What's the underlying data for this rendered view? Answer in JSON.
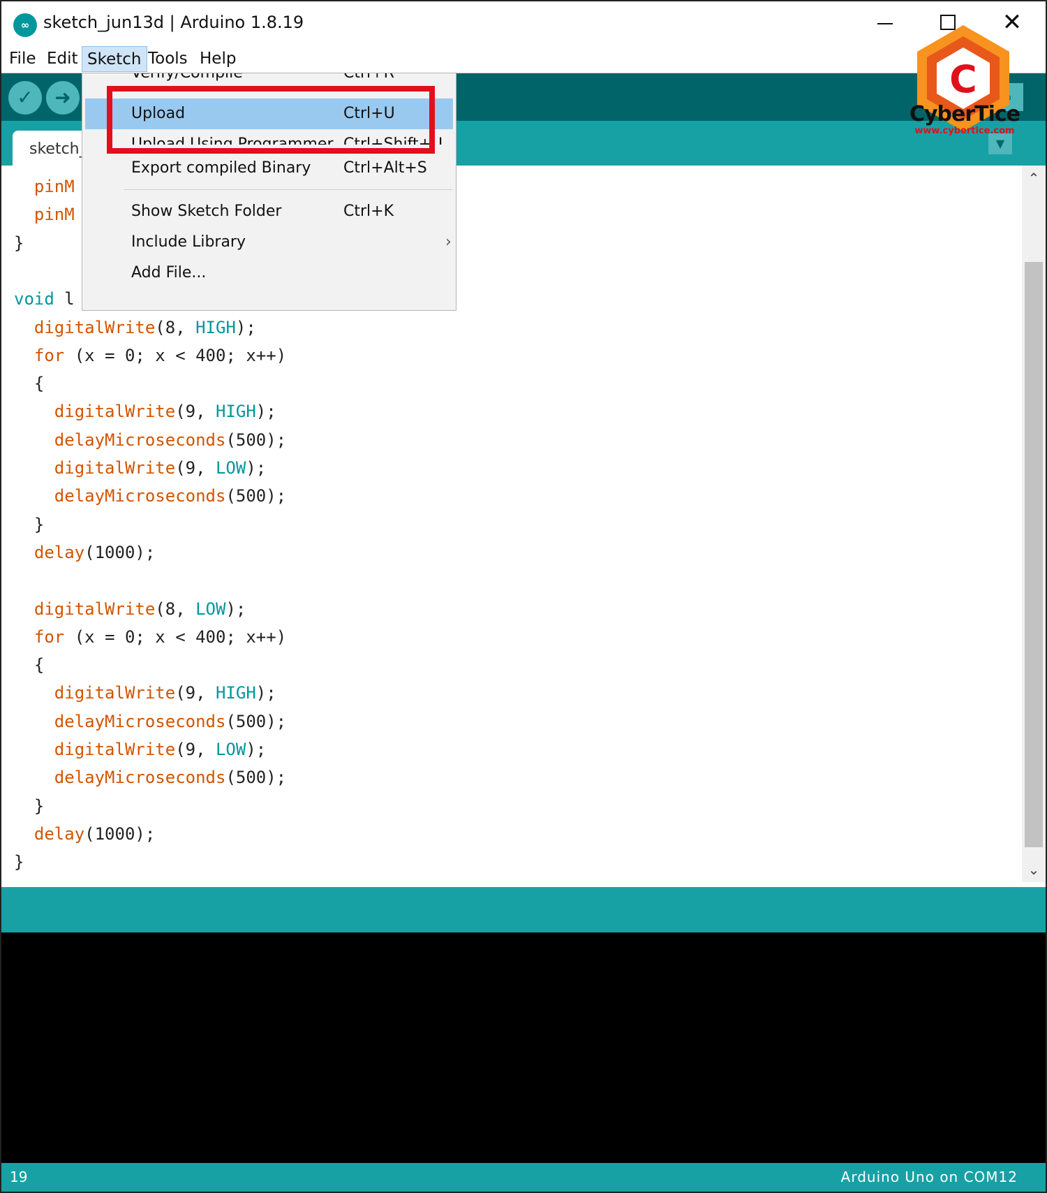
{
  "window": {
    "title": "sketch_jun13d | Arduino 1.8.19",
    "logo_glyph": "∞",
    "minimize_icon": "minimize-icon",
    "maximize_icon": "maximize-icon",
    "close_icon": "close-icon",
    "close_glyph": "✕"
  },
  "menubar": {
    "items": [
      "File",
      "Edit",
      "Sketch",
      "Tools",
      "Help"
    ],
    "active": "Sketch"
  },
  "toolbar": {
    "verify_glyph": "✓",
    "upload_glyph": "➜",
    "serial_glyph": "⌕"
  },
  "tabs": {
    "current": "sketch_",
    "menu_glyph": "▼"
  },
  "sketch_menu": {
    "items": [
      {
        "label": "Verify/Compile",
        "shortcut": "Ctrl+R",
        "clipped": true
      },
      {
        "label": "Upload",
        "shortcut": "Ctrl+U",
        "highlighted": true
      },
      {
        "label": "Upload Using Programmer",
        "shortcut": "Ctrl+Shift+U",
        "clipped": true
      },
      {
        "label": "Export compiled Binary",
        "shortcut": "Ctrl+Alt+S"
      },
      {
        "label": "Show Sketch Folder",
        "shortcut": "Ctrl+K"
      },
      {
        "label": "Include Library",
        "submenu_glyph": "›"
      },
      {
        "label": "Add File..."
      }
    ]
  },
  "editor": {
    "lines": [
      "  pinM",
      "  pinM",
      "}",
      "",
      "void l",
      "  digitalWrite(8, HIGH);",
      "  for (x = 0; x < 400; x++)",
      "  {",
      "    digitalWrite(9, HIGH);",
      "    delayMicroseconds(500);",
      "    digitalWrite(9, LOW);",
      "    delayMicroseconds(500);",
      "  }",
      "  delay(1000);",
      "",
      "  digitalWrite(8, LOW);",
      "  for (x = 0; x < 400; x++)",
      "  {",
      "    digitalWrite(9, HIGH);",
      "    delayMicroseconds(500);",
      "    digitalWrite(9, LOW);",
      "    delayMicroseconds(500);",
      "  }",
      "  delay(1000);",
      "}"
    ],
    "scroll_up_glyph": "⌃",
    "scroll_down_glyph": "⌄"
  },
  "status": {
    "line_number": "19",
    "board": "Arduino Uno on COM12"
  },
  "watermark": {
    "brand": "CyberTice",
    "url": "www.cybertice.com",
    "logo_letter": "C"
  },
  "colors": {
    "toolbar": "#006468",
    "tabstrip": "#17a1a5",
    "highlight": "#e0101c",
    "menu_hover": "#99c9ef"
  }
}
